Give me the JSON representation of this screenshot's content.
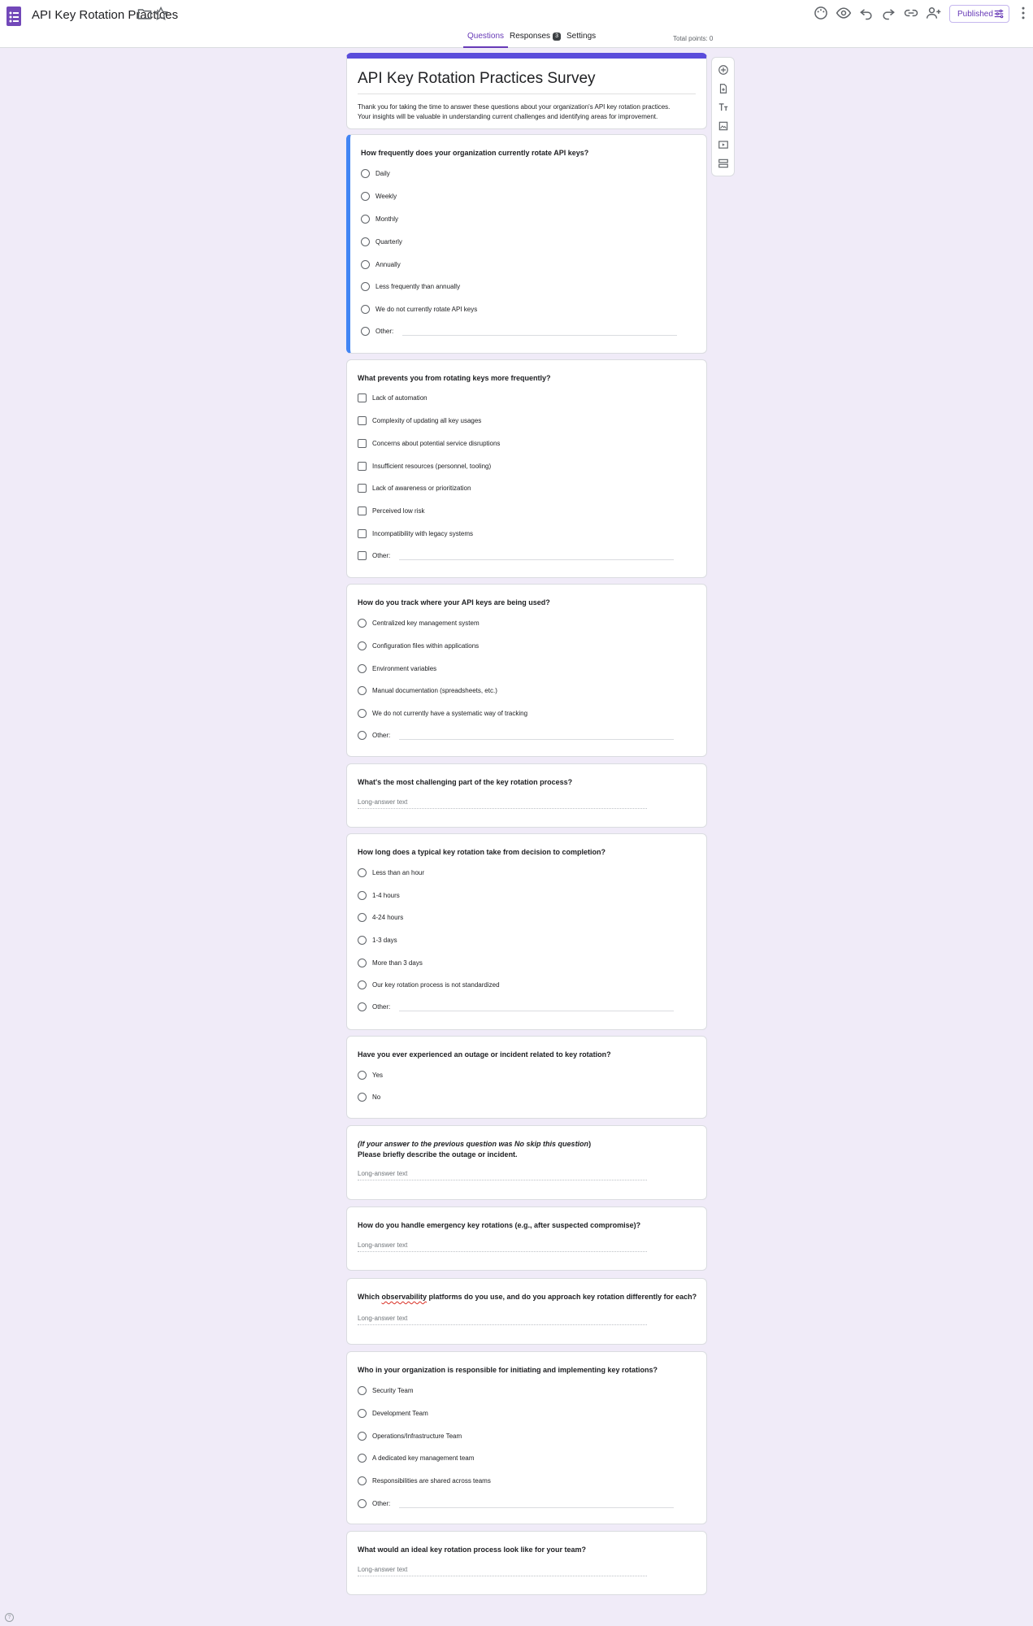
{
  "header": {
    "title": "API Key Rotation Practices",
    "published_label": "Published",
    "brand_color": "#673ab7",
    "icons": [
      "forms-logo-icon",
      "folder-icon",
      "star-icon",
      "palette-icon",
      "preview-icon",
      "undo-icon",
      "redo-icon",
      "link-icon",
      "add-collaborator-icon",
      "more-vert-icon"
    ]
  },
  "tabs": {
    "questions": "Questions",
    "responses": "Responses",
    "responses_count": "3",
    "settings": "Settings",
    "total_points": "Total points: 0"
  },
  "form": {
    "title": "API Key Rotation Practices Survey",
    "description_line1": "Thank you for taking the time to answer these questions about your organization's API key rotation practices.",
    "description_line2": "Your insights will be valuable in understanding current challenges and identifying areas for improvement.",
    "accent_color": "#5a4cdb"
  },
  "long_answer_placeholder": "Long-answer text",
  "other_label": "Other:",
  "q1": {
    "title": "How frequently does your organization currently rotate API keys?",
    "options": [
      "Daily",
      "Weekly",
      "Monthly",
      "Quarterly",
      "Annually",
      "Less frequently than annually",
      "We do not currently rotate API keys"
    ]
  },
  "q2": {
    "title": "What prevents you from rotating keys more frequently?",
    "options": [
      "Lack of automation",
      "Complexity of updating all key usages",
      "Concerns about potential service disruptions",
      "Insufficient resources (personnel, tooling)",
      "Lack of awareness or prioritization",
      "Perceived low risk",
      "Incompatibility with legacy systems"
    ]
  },
  "q3": {
    "title": "How do you track where your API keys are being used?",
    "options": [
      "Centralized key management system",
      "Configuration files within applications",
      "Environment variables",
      "Manual documentation (spreadsheets, etc.)",
      "We do not currently have a systematic way of tracking"
    ]
  },
  "q4": {
    "title": "What's the most challenging part of the key rotation process?"
  },
  "q5": {
    "title": "How long does a typical key rotation take from decision to completion?",
    "options": [
      "Less than an hour",
      "1-4 hours",
      "4-24 hours",
      "1-3 days",
      "More than 3 days",
      "Our key rotation process is not standardized"
    ]
  },
  "q6": {
    "title": "Have you ever experienced an outage or incident related to key rotation?",
    "options": [
      "Yes",
      "No"
    ]
  },
  "q7": {
    "title_italic_a": "(If your answer to the previous question was ",
    "title_italic_no": "No",
    "title_italic_b": " skip this question",
    "title_paren_close": ")",
    "title_line2": "Please briefly describe the outage or incident."
  },
  "q8": {
    "title": "How do you handle emergency key rotations (e.g., after suspected compromise)?"
  },
  "q9": {
    "title_a": "Which ",
    "title_misspelled": "observability",
    "title_b": " platforms do you use, and do you approach key rotation differently for each?"
  },
  "q10": {
    "title": "Who in your organization is responsible for initiating and implementing key rotations?",
    "options": [
      "Security Team",
      "Development Team",
      "Operations/Infrastructure Team",
      "A dedicated key management team",
      "Responsibilities are shared across teams"
    ]
  },
  "q11": {
    "title": "What would an ideal key rotation process look like for your team?"
  },
  "toolbar": {
    "icons": [
      "add-question-icon",
      "import-questions-icon",
      "add-title-icon",
      "add-image-icon",
      "add-video-icon",
      "add-section-icon"
    ]
  },
  "help": "?"
}
